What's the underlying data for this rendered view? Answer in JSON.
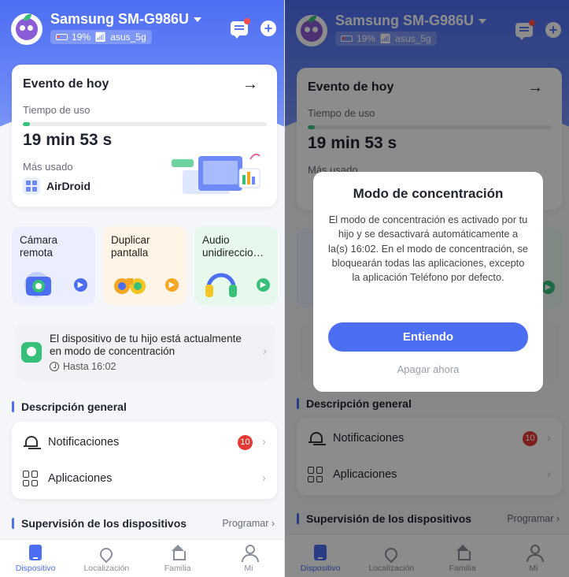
{
  "device": {
    "name": "Samsung SM-G986U",
    "battery": "19%",
    "wifi": "asus_5g"
  },
  "event": {
    "title": "Evento de hoy",
    "usage_label": "Tiempo de uso",
    "usage_progress_percent": 3,
    "usage_time": "19 min 53 s",
    "most_used_label": "Más usado",
    "most_used_app": "AirDroid"
  },
  "tiles": [
    {
      "label": "Cámara remota"
    },
    {
      "label": "Duplicar pantalla"
    },
    {
      "label": "Audio unidireccio…"
    }
  ],
  "focus_banner": {
    "text": "El dispositivo de tu hijo está actualmente en modo de concentración",
    "until": "Hasta 16:02"
  },
  "overview": {
    "title": "Descripción general",
    "notifications_label": "Notificaciones",
    "notifications_count": "10",
    "apps_label": "Aplicaciones"
  },
  "supervision": {
    "title": "Supervisión de los dispositivos",
    "schedule_label": "Programar"
  },
  "tabs": [
    {
      "label": "Dispositivo"
    },
    {
      "label": "Localización"
    },
    {
      "label": "Familia"
    },
    {
      "label": "Mi"
    }
  ],
  "modal": {
    "title": "Modo de concentración",
    "body": "El modo de concentración es activado por tu hijo y se desactivará automáticamente a la(s) 16:02. En el modo de concentración, se bloquearán todas las aplicaciones, excepto la aplicación Teléfono por defecto.",
    "confirm_label": "Entiendo",
    "secondary_label": "Apagar ahora"
  },
  "colors": {
    "accent": "#4b6ef2",
    "success": "#36c07a",
    "danger": "#e53935"
  }
}
